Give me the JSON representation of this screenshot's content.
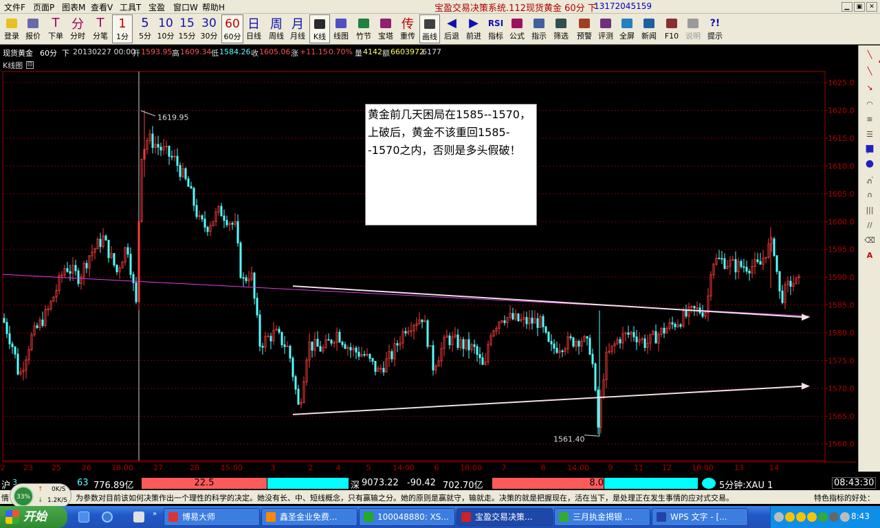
{
  "menu": {
    "items": [
      "文件F",
      "页面P",
      "图表M",
      "查看V",
      "工具T",
      "宝盈",
      "窗口W",
      "帮助H"
    ],
    "title": "宝盈交易决策系统.112现货黄金  60分  下",
    "phone": "13172045159"
  },
  "toolbar": [
    {
      "label": "登录",
      "icon": "key-icon"
    },
    {
      "label": "报价",
      "icon": "flag-icon"
    },
    {
      "label": "下单",
      "icon": "T-order-icon",
      "glyph": "T"
    },
    {
      "label": "分时",
      "icon": "fen-icon",
      "glyph": "分"
    },
    {
      "label": "分笔",
      "icon": "T-tick-icon",
      "glyph": "T"
    },
    {
      "label": "1分",
      "icon": "1min-icon",
      "glyph": "1"
    },
    {
      "label": "5分",
      "icon": "5min-icon",
      "glyph": "5"
    },
    {
      "label": "10分",
      "icon": "10min-icon",
      "glyph": "10"
    },
    {
      "label": "15分",
      "icon": "15min-icon",
      "glyph": "15"
    },
    {
      "label": "30分",
      "icon": "30min-icon",
      "glyph": "30"
    },
    {
      "label": "60分",
      "icon": "60min-icon",
      "glyph": "60"
    },
    {
      "label": "日线",
      "icon": "daily-icon",
      "glyph": "日"
    },
    {
      "label": "周线",
      "icon": "weekly-icon",
      "glyph": "周"
    },
    {
      "label": "月线",
      "icon": "monthly-icon",
      "glyph": "月"
    },
    {
      "label": "K线",
      "icon": "candle-icon"
    },
    {
      "label": "线图",
      "icon": "linechart-icon"
    },
    {
      "label": "竹节",
      "icon": "bamboo-icon"
    },
    {
      "label": "宝塔",
      "icon": "tower-icon"
    },
    {
      "label": "重传",
      "icon": "retransmit-icon",
      "glyph": "传"
    },
    {
      "label": "画线",
      "icon": "pen-icon"
    },
    {
      "label": "后退",
      "icon": "back-icon",
      "glyph": "◀"
    },
    {
      "label": "前进",
      "icon": "forward-icon",
      "glyph": "▶"
    },
    {
      "label": "指标",
      "icon": "rsi-icon",
      "glyph": "RSI"
    },
    {
      "label": "公式",
      "icon": "formula-icon"
    },
    {
      "label": "指示",
      "icon": "indicator-icon"
    },
    {
      "label": "筛选",
      "icon": "filter-icon"
    },
    {
      "label": "预警",
      "icon": "alert-icon"
    },
    {
      "label": "评测",
      "icon": "evaluate-icon"
    },
    {
      "label": "全屏",
      "icon": "fullscreen-icon"
    },
    {
      "label": "新闻",
      "icon": "news-icon"
    },
    {
      "label": "F10",
      "icon": "books-icon"
    },
    {
      "label": "说明",
      "icon": "help-book-icon"
    },
    {
      "label": "提示",
      "icon": "tip-icon",
      "glyph": "?!"
    }
  ],
  "infobar": {
    "symbol": "现货黄金",
    "period": "60分",
    "dir": "下",
    "datetime": "20130227  00:00",
    "open_label": "开",
    "open": "1593.95",
    "high_label": "高",
    "high": "1609.34",
    "low_label": "低",
    "low": "1584.26",
    "close_label": "收",
    "close": "1605.06",
    "change_label": "涨",
    "change": "+11.15",
    "pct": "0.70%",
    "vol_label": "量",
    "vol": "4142",
    "amt_label": "额",
    "amt": "6603972",
    "extra": "6177"
  },
  "panel": {
    "label": "K线图",
    "toggle": "⊟"
  },
  "chart_data": {
    "type": "candlestick",
    "ylim": [
      1557,
      1627
    ],
    "y_ticks": [
      "1625.0",
      "1620.0",
      "1615.0",
      "1610.0",
      "1605.0",
      "1600.0",
      "1595.0",
      "1590.0",
      "1585.0",
      "1580.0",
      "1575.0",
      "1570.0",
      "1565.0",
      "1560.0"
    ],
    "x_labels": [
      "2",
      "23",
      "25",
      "26",
      "18:00",
      "27",
      "28",
      "15:00",
      "3",
      "2",
      "4",
      "5",
      "14:00",
      "6",
      "18:00",
      "7",
      "8",
      "14:00",
      "9",
      "11",
      "12",
      "18:00",
      "13",
      "14"
    ],
    "annotations": [
      {
        "text": "1619.95",
        "value": 1619.95
      },
      {
        "text": "1561.40",
        "value": 1561.4
      }
    ],
    "trendlines": [
      {
        "name": "magenta",
        "color": "#e040e0",
        "from": [
          0,
          1590.5
        ],
        "to": [
          1,
          1583.0
        ]
      },
      {
        "name": "upper",
        "color": "#f0e0e8",
        "from": [
          0.37,
          1588.4
        ],
        "to": [
          1,
          1582.8
        ]
      },
      {
        "name": "lower",
        "color": "#f0e0e8",
        "from": [
          0.37,
          1565.3
        ],
        "to": [
          1,
          1570.4
        ]
      }
    ],
    "up_color": "#ff3b3b",
    "down_color": "#54ffff"
  },
  "note": {
    "text": "黄金前几天困局在1585--1570，上破后，黄金不该重回1585--1570之内，否则是多头假破！"
  },
  "quotebar": {
    "sh_label": "沪",
    "sh_value": "3",
    "sh_change": "63",
    "sh_amount": "776.89亿",
    "sh_bar_value": "22.5",
    "sz_label": "深",
    "sz_value": "9073.22",
    "sz_change": "-90.42",
    "sz_amount": "702.70亿",
    "sz_bar_value": "8.0",
    "period_label": "5分钟:XAU 1",
    "time": "08:43:30"
  },
  "ticker": {
    "left": "情",
    "text": "为参数对目前该如何决策作出一个理性的科学的决定。她没有长、中、短线概念，只有赢输之分。她的原则是赢就守，输就走。决策的就是把握现在，活在当下，是处理正在发生事情的应对式交易。",
    "right": "特色指标的好处："
  },
  "netwidget": {
    "pct": "33%",
    "up": "0K/S",
    "down": "1.2K/S"
  },
  "taskbar": {
    "start": "开始",
    "tasks": [
      {
        "label": "博易大师",
        "color": "#d33"
      },
      {
        "label": "鑫圣金业免费...",
        "color": "#f80"
      },
      {
        "label": "100048880: XS...",
        "color": "#2a2"
      },
      {
        "label": "宝盈交易决策...",
        "color": "#c22"
      },
      {
        "label": "三月执金揭银 ...",
        "color": "#3a3"
      },
      {
        "label": "WPS 文字 - [...",
        "color": "#24a"
      }
    ],
    "clock": "8:43"
  }
}
